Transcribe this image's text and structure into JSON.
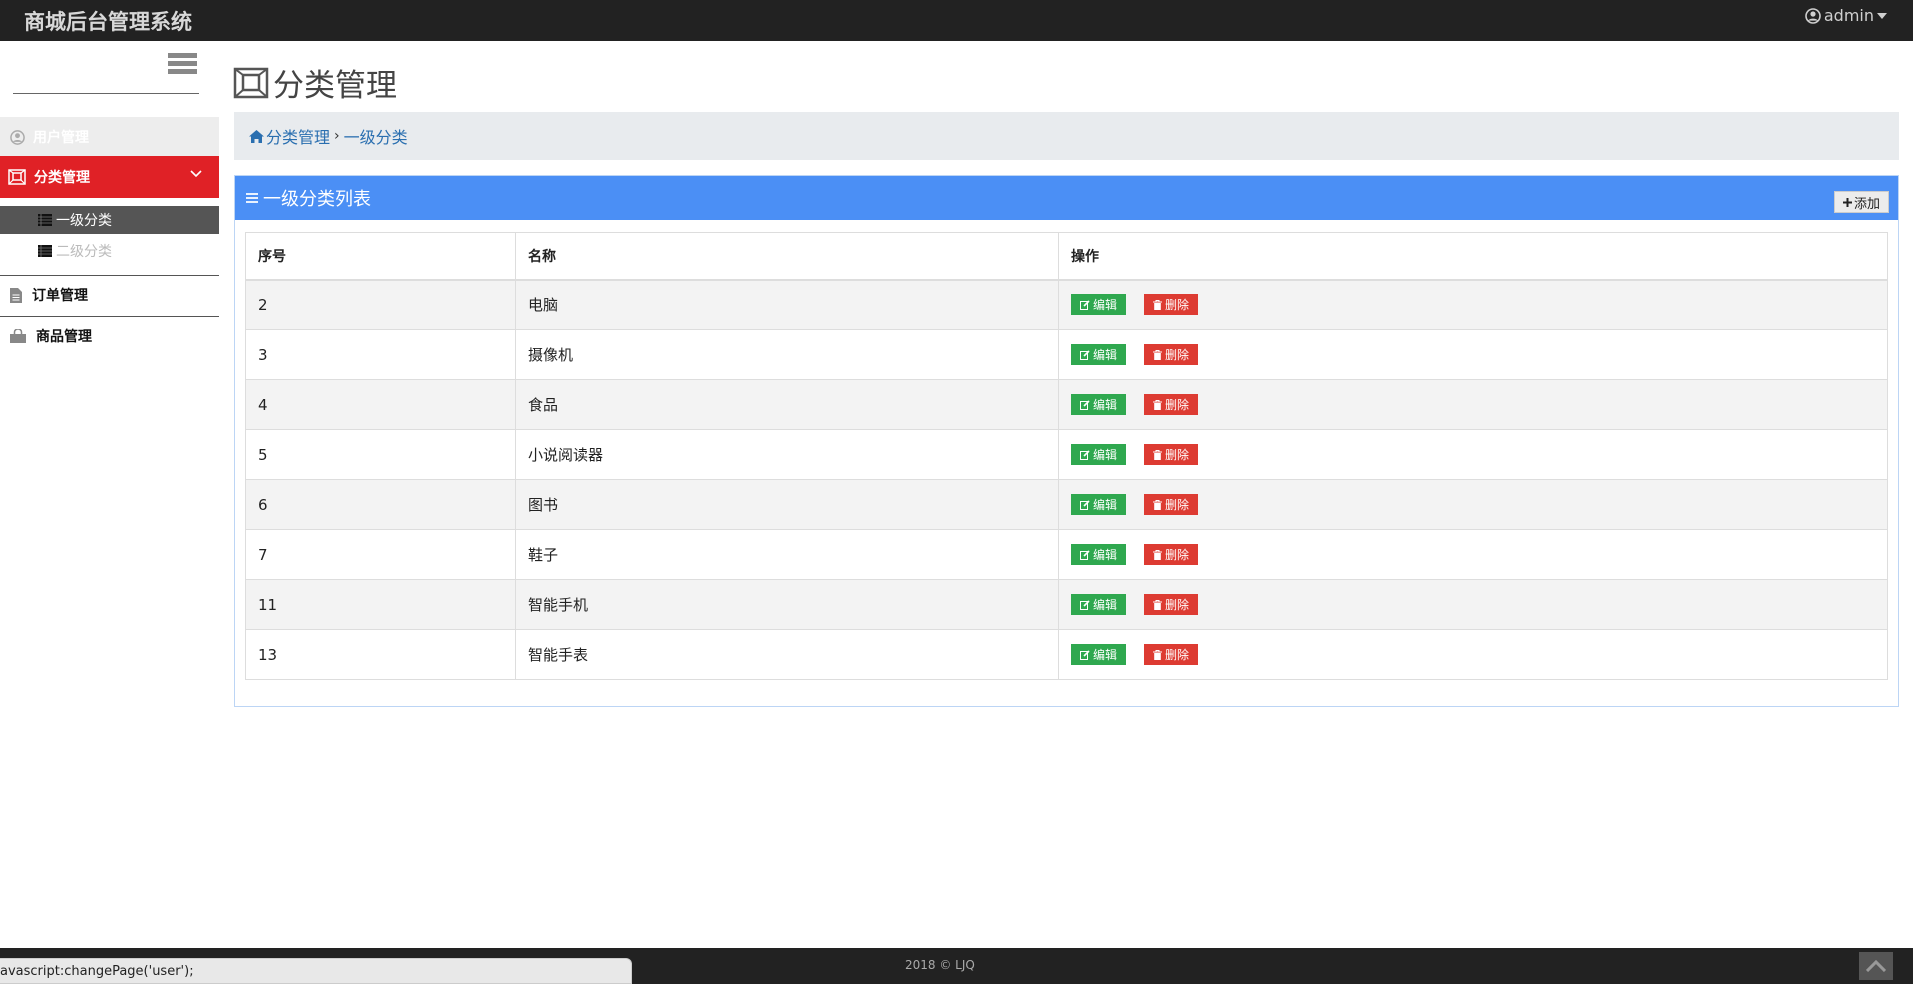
{
  "header": {
    "brand": "商城后台管理系统",
    "user": "admin",
    "icons": [
      "user-circle-icon",
      "caret-down-icon"
    ]
  },
  "sidebar": {
    "items": [
      {
        "label": "用户管理",
        "icon": "user-circle-icon"
      },
      {
        "label": "分类管理",
        "icon": "category-icon",
        "expanded": true,
        "children": [
          {
            "label": "一级分类",
            "active": true
          },
          {
            "label": "二级分类"
          }
        ]
      },
      {
        "label": "订单管理",
        "icon": "document-icon"
      },
      {
        "label": "商品管理",
        "icon": "shopping-bag-icon"
      }
    ],
    "colors": {
      "active": "#e02126",
      "sub_active": "#555555"
    }
  },
  "page": {
    "title": "分类管理",
    "breadcrumb": {
      "root": "分类管理",
      "current": "一级分类"
    }
  },
  "panel": {
    "title": "一级分类列表",
    "add_label": "添加",
    "color": "#4b8ff5"
  },
  "table": {
    "headers": [
      "序号",
      "名称",
      "操作"
    ],
    "edit_label": "编辑",
    "delete_label": "删除",
    "rows": [
      {
        "id": "2",
        "name": "电脑"
      },
      {
        "id": "3",
        "name": "摄像机"
      },
      {
        "id": "4",
        "name": "食品"
      },
      {
        "id": "5",
        "name": "小说阅读器"
      },
      {
        "id": "6",
        "name": "图书"
      },
      {
        "id": "7",
        "name": "鞋子"
      },
      {
        "id": "11",
        "name": "智能手机"
      },
      {
        "id": "13",
        "name": "智能手表"
      }
    ]
  },
  "footer": {
    "copyright": "2018 © LJQ"
  },
  "status_bar": {
    "text": "avascript:changePage('user');"
  }
}
